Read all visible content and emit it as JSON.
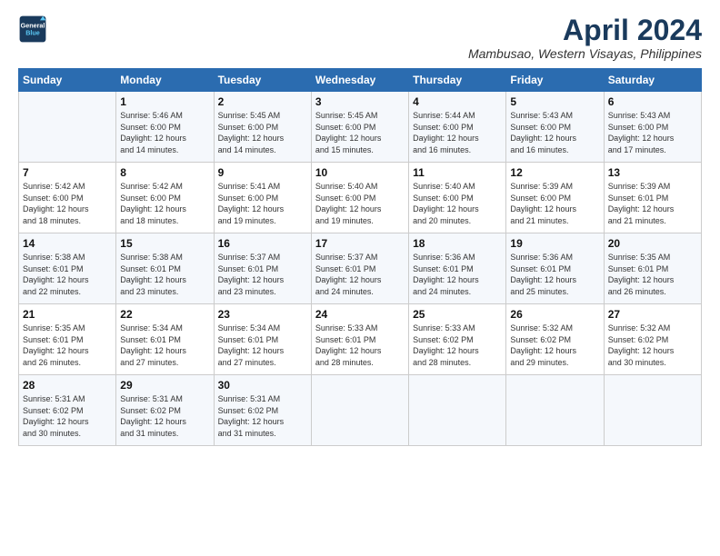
{
  "header": {
    "logo_line1": "General",
    "logo_line2": "Blue",
    "month_year": "April 2024",
    "location": "Mambusao, Western Visayas, Philippines"
  },
  "days_of_week": [
    "Sunday",
    "Monday",
    "Tuesday",
    "Wednesday",
    "Thursday",
    "Friday",
    "Saturday"
  ],
  "weeks": [
    [
      {
        "day": "",
        "text": ""
      },
      {
        "day": "1",
        "text": "Sunrise: 5:46 AM\nSunset: 6:00 PM\nDaylight: 12 hours\nand 14 minutes."
      },
      {
        "day": "2",
        "text": "Sunrise: 5:45 AM\nSunset: 6:00 PM\nDaylight: 12 hours\nand 14 minutes."
      },
      {
        "day": "3",
        "text": "Sunrise: 5:45 AM\nSunset: 6:00 PM\nDaylight: 12 hours\nand 15 minutes."
      },
      {
        "day": "4",
        "text": "Sunrise: 5:44 AM\nSunset: 6:00 PM\nDaylight: 12 hours\nand 16 minutes."
      },
      {
        "day": "5",
        "text": "Sunrise: 5:43 AM\nSunset: 6:00 PM\nDaylight: 12 hours\nand 16 minutes."
      },
      {
        "day": "6",
        "text": "Sunrise: 5:43 AM\nSunset: 6:00 PM\nDaylight: 12 hours\nand 17 minutes."
      }
    ],
    [
      {
        "day": "7",
        "text": "Sunrise: 5:42 AM\nSunset: 6:00 PM\nDaylight: 12 hours\nand 18 minutes."
      },
      {
        "day": "8",
        "text": "Sunrise: 5:42 AM\nSunset: 6:00 PM\nDaylight: 12 hours\nand 18 minutes."
      },
      {
        "day": "9",
        "text": "Sunrise: 5:41 AM\nSunset: 6:00 PM\nDaylight: 12 hours\nand 19 minutes."
      },
      {
        "day": "10",
        "text": "Sunrise: 5:40 AM\nSunset: 6:00 PM\nDaylight: 12 hours\nand 19 minutes."
      },
      {
        "day": "11",
        "text": "Sunrise: 5:40 AM\nSunset: 6:00 PM\nDaylight: 12 hours\nand 20 minutes."
      },
      {
        "day": "12",
        "text": "Sunrise: 5:39 AM\nSunset: 6:00 PM\nDaylight: 12 hours\nand 21 minutes."
      },
      {
        "day": "13",
        "text": "Sunrise: 5:39 AM\nSunset: 6:01 PM\nDaylight: 12 hours\nand 21 minutes."
      }
    ],
    [
      {
        "day": "14",
        "text": "Sunrise: 5:38 AM\nSunset: 6:01 PM\nDaylight: 12 hours\nand 22 minutes."
      },
      {
        "day": "15",
        "text": "Sunrise: 5:38 AM\nSunset: 6:01 PM\nDaylight: 12 hours\nand 23 minutes."
      },
      {
        "day": "16",
        "text": "Sunrise: 5:37 AM\nSunset: 6:01 PM\nDaylight: 12 hours\nand 23 minutes."
      },
      {
        "day": "17",
        "text": "Sunrise: 5:37 AM\nSunset: 6:01 PM\nDaylight: 12 hours\nand 24 minutes."
      },
      {
        "day": "18",
        "text": "Sunrise: 5:36 AM\nSunset: 6:01 PM\nDaylight: 12 hours\nand 24 minutes."
      },
      {
        "day": "19",
        "text": "Sunrise: 5:36 AM\nSunset: 6:01 PM\nDaylight: 12 hours\nand 25 minutes."
      },
      {
        "day": "20",
        "text": "Sunrise: 5:35 AM\nSunset: 6:01 PM\nDaylight: 12 hours\nand 26 minutes."
      }
    ],
    [
      {
        "day": "21",
        "text": "Sunrise: 5:35 AM\nSunset: 6:01 PM\nDaylight: 12 hours\nand 26 minutes."
      },
      {
        "day": "22",
        "text": "Sunrise: 5:34 AM\nSunset: 6:01 PM\nDaylight: 12 hours\nand 27 minutes."
      },
      {
        "day": "23",
        "text": "Sunrise: 5:34 AM\nSunset: 6:01 PM\nDaylight: 12 hours\nand 27 minutes."
      },
      {
        "day": "24",
        "text": "Sunrise: 5:33 AM\nSunset: 6:01 PM\nDaylight: 12 hours\nand 28 minutes."
      },
      {
        "day": "25",
        "text": "Sunrise: 5:33 AM\nSunset: 6:02 PM\nDaylight: 12 hours\nand 28 minutes."
      },
      {
        "day": "26",
        "text": "Sunrise: 5:32 AM\nSunset: 6:02 PM\nDaylight: 12 hours\nand 29 minutes."
      },
      {
        "day": "27",
        "text": "Sunrise: 5:32 AM\nSunset: 6:02 PM\nDaylight: 12 hours\nand 30 minutes."
      }
    ],
    [
      {
        "day": "28",
        "text": "Sunrise: 5:31 AM\nSunset: 6:02 PM\nDaylight: 12 hours\nand 30 minutes."
      },
      {
        "day": "29",
        "text": "Sunrise: 5:31 AM\nSunset: 6:02 PM\nDaylight: 12 hours\nand 31 minutes."
      },
      {
        "day": "30",
        "text": "Sunrise: 5:31 AM\nSunset: 6:02 PM\nDaylight: 12 hours\nand 31 minutes."
      },
      {
        "day": "",
        "text": ""
      },
      {
        "day": "",
        "text": ""
      },
      {
        "day": "",
        "text": ""
      },
      {
        "day": "",
        "text": ""
      }
    ]
  ]
}
